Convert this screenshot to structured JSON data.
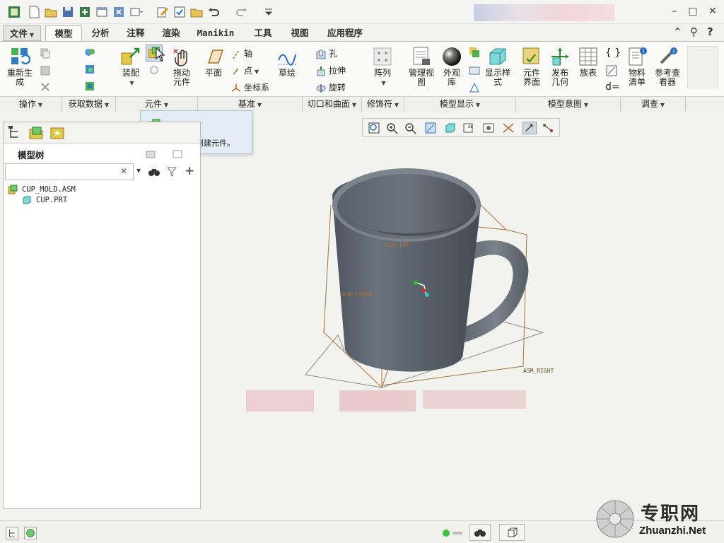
{
  "window": {
    "minimize": "–",
    "maximize": "□",
    "close": "✕"
  },
  "tabs": [
    {
      "label": "文件",
      "kind": "file"
    },
    {
      "label": "模型",
      "kind": "active"
    },
    {
      "label": "分析"
    },
    {
      "label": "注释"
    },
    {
      "label": "渲染"
    },
    {
      "label": "Manikin"
    },
    {
      "label": "工具"
    },
    {
      "label": "视图"
    },
    {
      "label": "应用程序"
    }
  ],
  "ribbon": {
    "regenerate": "重新生成",
    "assemble": "装配",
    "drag_components": "拖动元件",
    "plane": "平面",
    "axis": "轴",
    "point": "点",
    "csys": "坐标系",
    "sketch": "草绘",
    "hole": "孔",
    "extrude": "拉伸",
    "revolve": "旋转",
    "pattern": "阵列",
    "manage_views": "管理视图",
    "appearance_gallery": "外观库",
    "display_style": "显示样式",
    "component_interface": "元件界面",
    "publish_geometry": "发布几何",
    "family_table": "族表",
    "bom": "物料清单",
    "reference_viewer": "参考查看器",
    "d_equals": "d="
  },
  "groups": [
    {
      "label": "操作"
    },
    {
      "label": "获取数据"
    },
    {
      "label": "元件"
    },
    {
      "label": "基准"
    },
    {
      "label": "切口和曲面"
    },
    {
      "label": "修饰符"
    },
    {
      "label": "模型显示"
    },
    {
      "label": "模型意图"
    },
    {
      "label": "调查"
    }
  ],
  "tooltip": {
    "title": "创建",
    "description": "在装配模式下创建元件。"
  },
  "model_tree": {
    "label": "模型树",
    "search_placeholder": "",
    "items": [
      {
        "name": "CUP_MOLD.ASM",
        "level": 0
      },
      {
        "name": "CUP.PRT",
        "level": 1
      }
    ]
  },
  "viewport": {
    "datum_labels": [
      "ASM_TOP",
      "ASM_FRONT",
      "ASM_RIGHT"
    ]
  },
  "watermark": {
    "title": "专职网",
    "url": "Zhuanzhi.Net"
  },
  "colors": {
    "active_tab_bg": "#fafaf8",
    "tooltip_bg": "#e3ecf5",
    "datum_plane": "#a8733a",
    "model_body": "#5e6670",
    "status_green": "#3cc23c"
  }
}
